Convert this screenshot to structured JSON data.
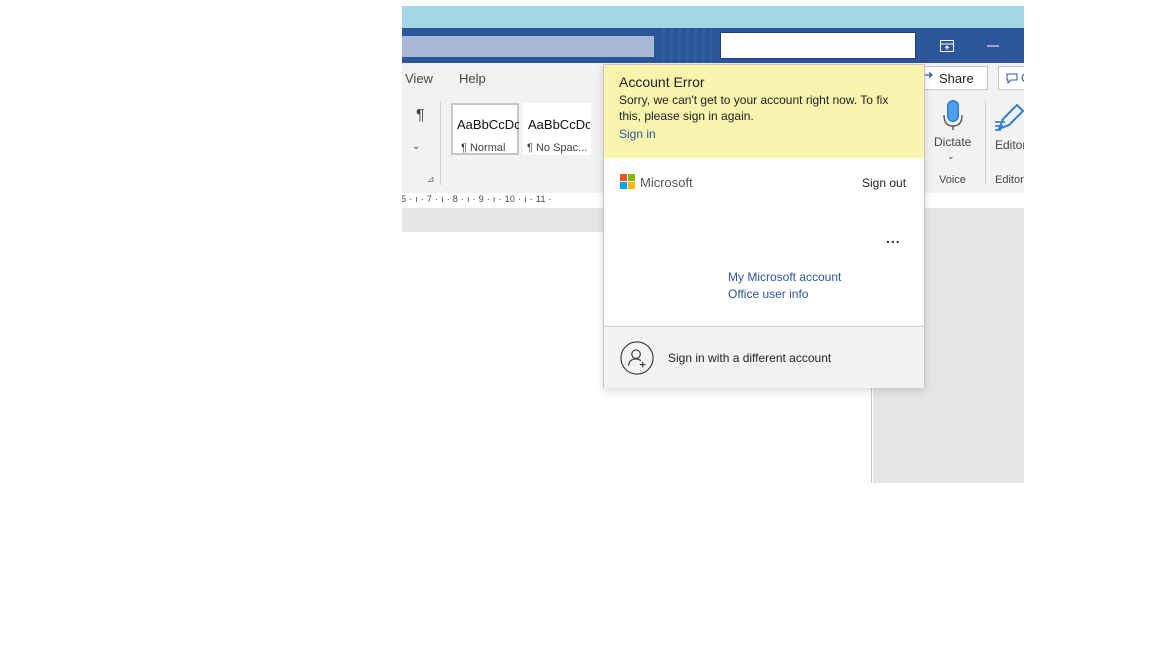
{
  "window": {
    "title_bar_color": "#2b579a",
    "tabs": [
      {
        "label": "View"
      },
      {
        "label": "Help"
      }
    ],
    "share_label": "Share",
    "comment_label": "C"
  },
  "ribbon": {
    "pilcrow": "¶",
    "styles": [
      {
        "sample": "AaBbCcDc",
        "name": "¶ Normal"
      },
      {
        "sample": "AaBbCcDc",
        "name": "¶ No Spac..."
      }
    ],
    "dictate_label": "Dictate",
    "voice_group_label": "Voice",
    "editor_label": "Editor",
    "editor_group_label": "Editor"
  },
  "ruler": {
    "text": "5 · ı · 7 · ı · 8 · ı · 9 · ı · 10 · ı · 11 ·"
  },
  "account_flyout": {
    "error": {
      "title": "Account Error",
      "message": "Sorry, we can't get to your account right now. To fix this, please sign in again.",
      "sign_in_link": "Sign in"
    },
    "brand": "Microsoft",
    "sign_out": "Sign out",
    "more": "...",
    "links": [
      {
        "label": "My Microsoft account"
      },
      {
        "label": "Office user info"
      }
    ],
    "other_account": "Sign in with a different account",
    "colors": {
      "banner": "#f8f4ad",
      "link": "#2b579a"
    }
  }
}
